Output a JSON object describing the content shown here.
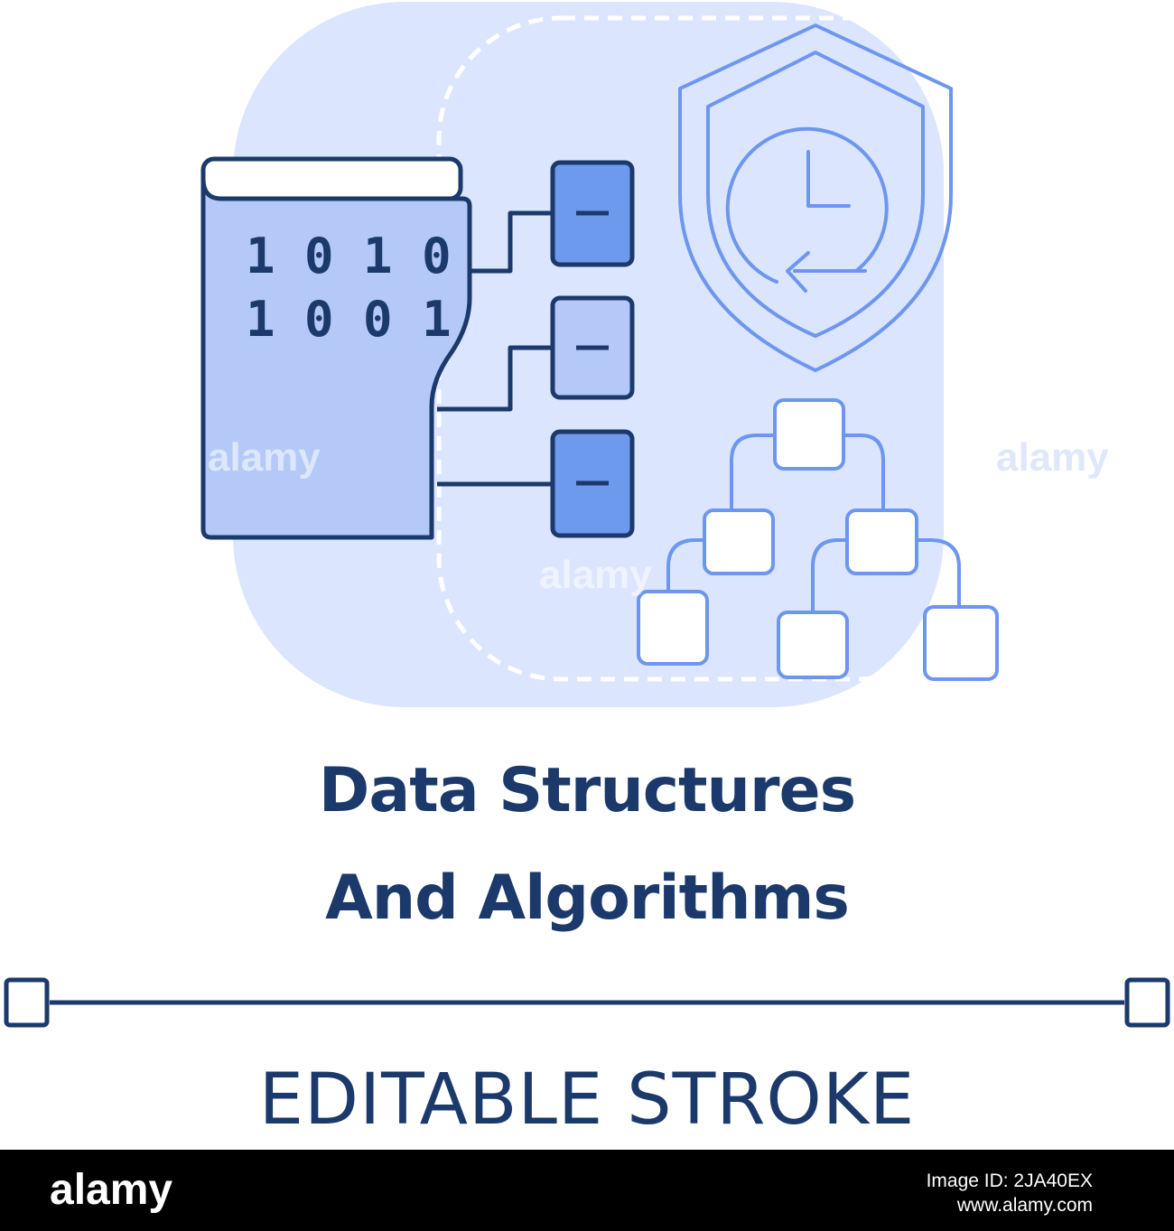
{
  "illustration": {
    "binary_row_1": "1 0 1 0",
    "binary_row_2": "1 0 0 1",
    "colors": {
      "background_blob": "#dbe5fd",
      "panel_dashed": "#ffffff",
      "outline_dark": "#1b3a6b",
      "outline_light": "#6d96ee",
      "book_fill": "#b4c9f8",
      "block_dark_fill": "#6e9aee",
      "block_light_fill": "#b4c9f8"
    },
    "icons": [
      "binary-book-icon",
      "memory-block-icon",
      "shield-clock-icon",
      "tree-diagram-icon"
    ]
  },
  "title": {
    "line1": "Data Structures",
    "line2": "And Algorithms",
    "color": "#1b3a6b"
  },
  "editable_stroke": {
    "label": "EDITABLE STROKE",
    "color": "#1b3a6b"
  },
  "footer": {
    "brand": "alamy",
    "image_id_line": "Image ID: 2JA40EX",
    "site": "www.alamy.com"
  },
  "watermark": {
    "text": "alamy",
    "short": "a"
  }
}
